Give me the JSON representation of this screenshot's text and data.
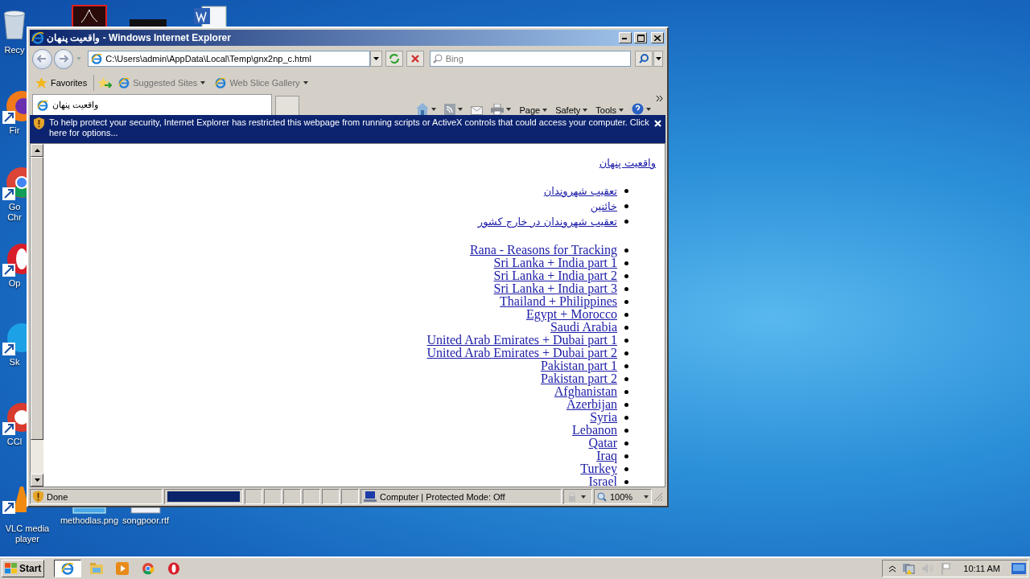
{
  "desktop": {
    "icons": [
      {
        "kind": "recycle",
        "label": "Recy"
      },
      {
        "kind": "acrobat"
      },
      {
        "kind": "dark"
      },
      {
        "kind": "word"
      },
      {
        "kind": "firefox",
        "label": "Fir"
      },
      {
        "kind": "chrome",
        "label": "Go\nChr"
      },
      {
        "kind": "opera",
        "label": "Op"
      },
      {
        "kind": "skype",
        "label": "Sk"
      },
      {
        "kind": "ccleaner",
        "label": "CCl"
      },
      {
        "kind": "vlc",
        "label": "VLC media\nplayer"
      },
      {
        "kind": "image",
        "label": "methodlas.png"
      },
      {
        "kind": "doc",
        "label": "songpoor.rtf"
      }
    ]
  },
  "window": {
    "title": "واقعیت پنهان - Windows Internet Explorer",
    "address": "C:\\Users\\admin\\AppData\\Local\\Temp\\gnx2np_c.html",
    "search": {
      "placeholder": "Bing"
    },
    "favorites_bar": {
      "favorites": "Favorites",
      "items": [
        "Suggested Sites",
        "Web Slice Gallery"
      ]
    },
    "tab": {
      "title": "واقعیت پنهان"
    },
    "command_bar": [
      "Page",
      "Safety",
      "Tools"
    ],
    "info_bar": "To help protect your security, Internet Explorer has restricted this webpage from running scripts or ActiveX controls that could access your computer. Click here for options...",
    "page": {
      "heading": "واقعیت پنهان",
      "persian_links": [
        "تعقیب شهروندان",
        "خائنین",
        "تعقیب شهروندان در خارج کشور"
      ],
      "country_links": [
        "Rana - Reasons for Tracking",
        "Sri Lanka + India part 1",
        "Sri Lanka + India part 2",
        "Sri Lanka + India part 3",
        "Thailand + Philippines",
        "Egypt + Morocco",
        "Saudi Arabia",
        "United Arab Emirates + Dubai part 1",
        "United Arab Emirates + Dubai part 2",
        "Pakistan part 1",
        "Pakistan part 2",
        "Afghanistan",
        "Azerbijan",
        "Syria",
        "Lebanon",
        "Qatar",
        "Iraq",
        "Turkey",
        "Israel"
      ]
    },
    "status_bar": {
      "status": "Done",
      "progress": {
        "level": 1
      },
      "zone": "Computer | Protected Mode: Off",
      "zoom": "100%"
    }
  },
  "taskbar": {
    "start": "Start",
    "clock": "10:11 AM"
  }
}
